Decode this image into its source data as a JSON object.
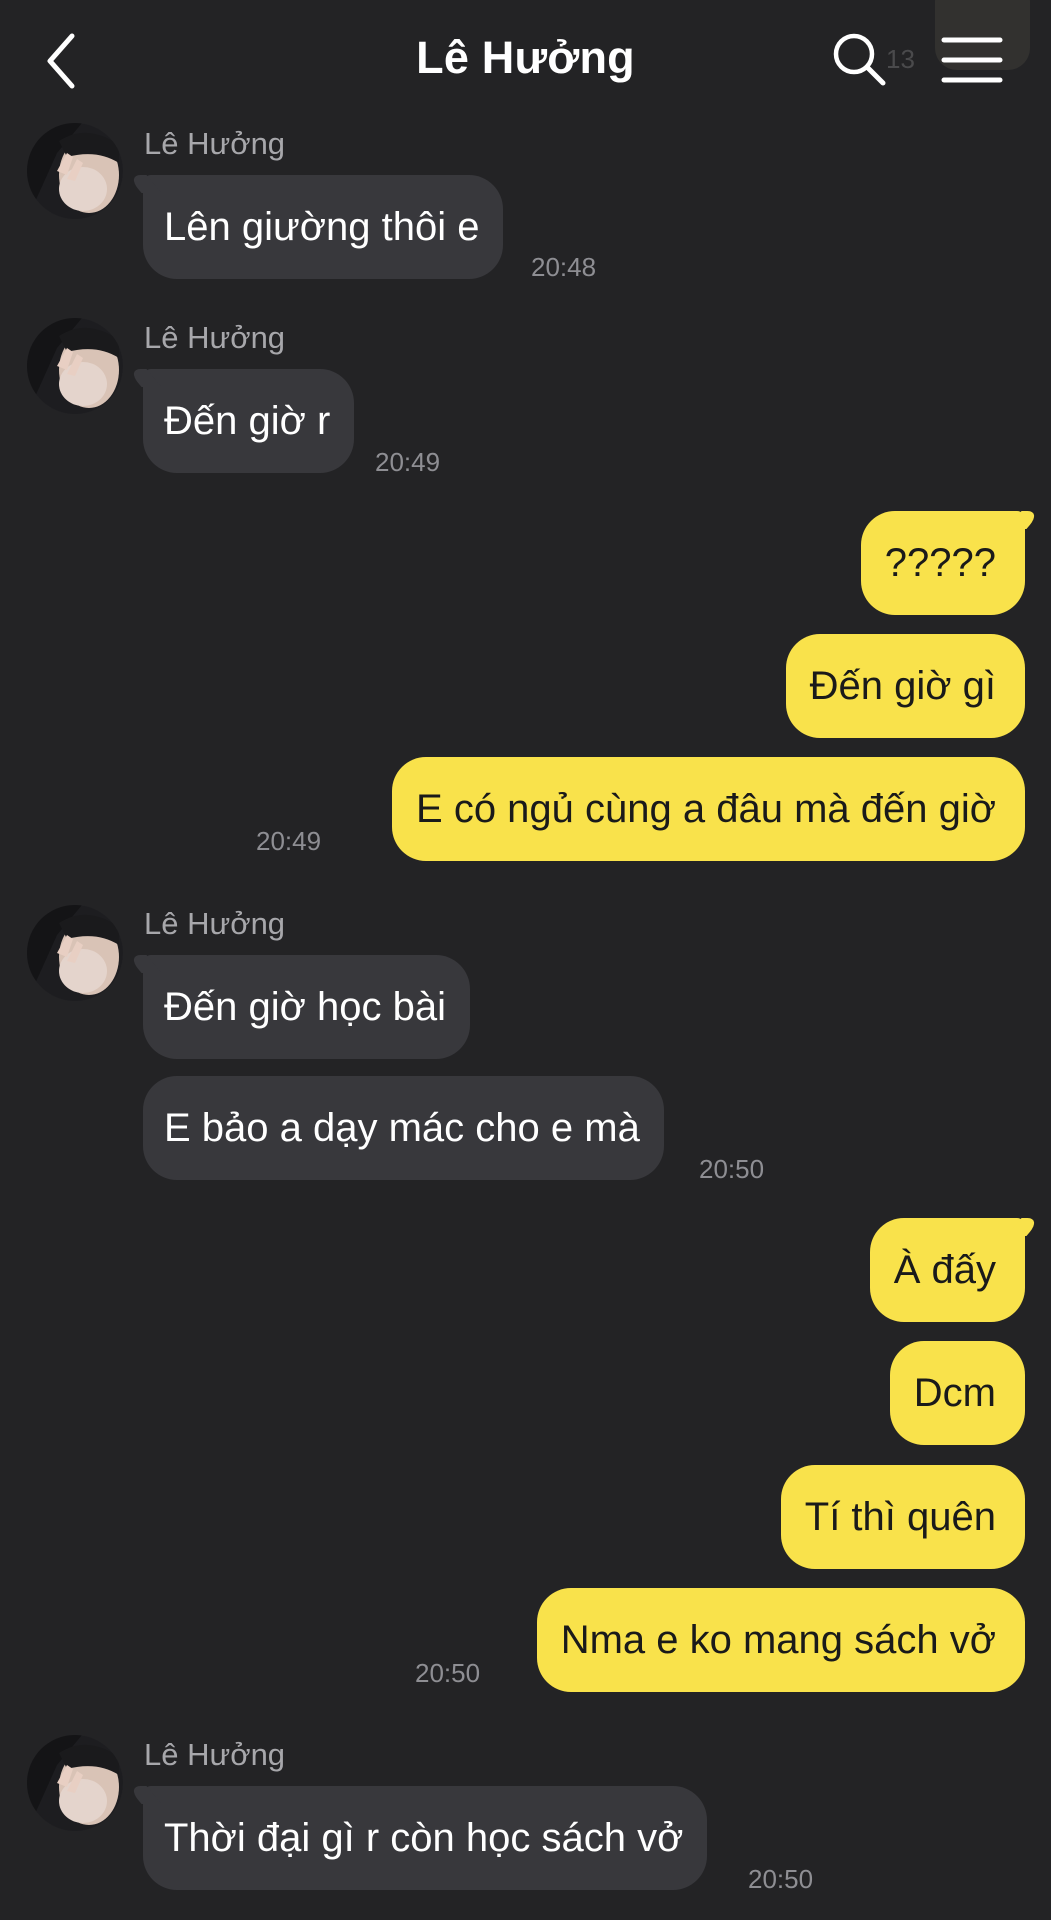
{
  "header": {
    "title": "Lê Hưởng",
    "ghost_text": "13"
  },
  "colors": {
    "background": "#232325",
    "incoming_bubble": "#38383c",
    "outgoing_bubble": "#f9e24b",
    "timestamp": "#8e8e93",
    "sender_name": "#a7a7ab"
  },
  "icons": {
    "back": "chevron-left-icon",
    "search": "search-icon",
    "menu": "hamburger-menu-icon"
  },
  "messages": [
    {
      "sender": "Lê Hưởng",
      "text": "Lên giường thôi e",
      "time": "20:48",
      "direction": "in"
    },
    {
      "sender": "Lê Hưởng",
      "text": "Đến giờ r",
      "time": "20:49",
      "direction": "in"
    },
    {
      "text": "?????",
      "direction": "out"
    },
    {
      "text": "Đến giờ gì",
      "direction": "out"
    },
    {
      "text": "E có ngủ cùng a đâu mà đến giờ",
      "time": "20:49",
      "direction": "out"
    },
    {
      "sender": "Lê Hưởng",
      "text": "Đến giờ học bài",
      "direction": "in"
    },
    {
      "text": "E bảo a dạy mác cho e mà",
      "time": "20:50",
      "direction": "in"
    },
    {
      "text": "À đấy",
      "direction": "out"
    },
    {
      "text": "Dcm",
      "direction": "out"
    },
    {
      "text": "Tí thì quên",
      "direction": "out"
    },
    {
      "text": "Nma e ko mang sách vở",
      "time": "20:50",
      "direction": "out"
    },
    {
      "sender": "Lê Hưởng",
      "text": "Thời đại gì r còn học sách vở",
      "time": "20:50",
      "direction": "in"
    }
  ]
}
